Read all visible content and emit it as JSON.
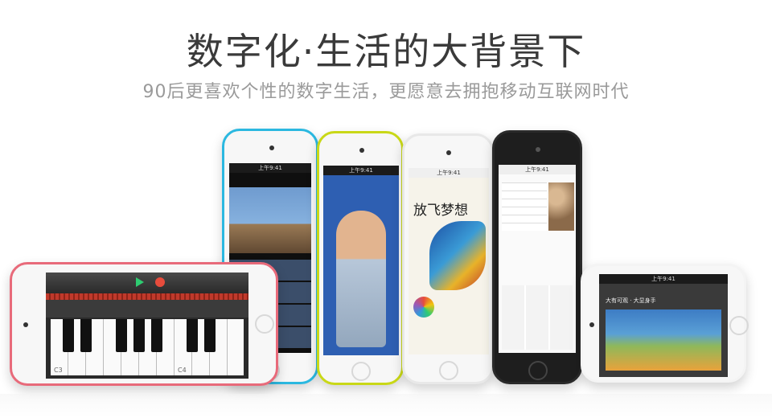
{
  "headline": "数字化·生活的大背景下",
  "subheadline": "90后更喜欢个性的数字生活，更愿意去拥抱移动互联网时代",
  "devices": {
    "blue": {
      "status_text": "上午9:41",
      "colors": {
        "frame": "#2bb8e0"
      }
    },
    "yellow": {
      "status_text": "上午9:41",
      "colors": {
        "frame": "#c9d817"
      }
    },
    "white": {
      "status_text": "上午9:41",
      "book_title": "放飞梦想",
      "colors": {
        "frame": "#e8e8e8"
      }
    },
    "black": {
      "status_text": "上午9:41",
      "colors": {
        "frame": "#2a2a2a"
      }
    },
    "landscape_right": {
      "status_text": "上午9:41",
      "slide_title": "大有可观 · 大显身手",
      "colors": {
        "frame": "#f4f4f4"
      }
    },
    "pink_piano": {
      "colors": {
        "frame": "#e86a7a"
      },
      "labels": {
        "c3": "C3",
        "c4": "C4"
      }
    }
  }
}
